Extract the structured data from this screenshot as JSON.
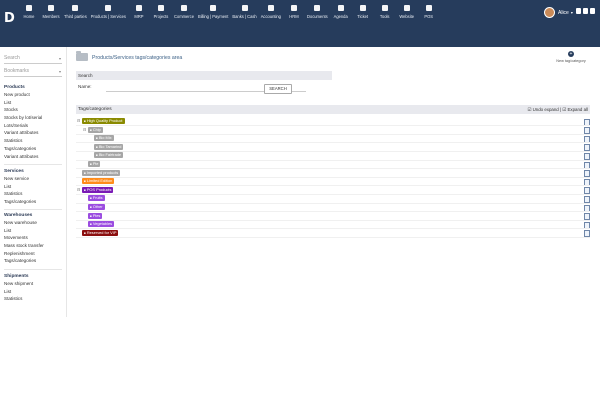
{
  "app": {
    "logo": "D"
  },
  "menu": [
    {
      "label": "Home",
      "icon": "home-icon"
    },
    {
      "label": "Members",
      "icon": "members-icon"
    },
    {
      "label": "Third parties",
      "icon": "third-parties-icon"
    },
    {
      "label": "Products | Services",
      "icon": "products-icon"
    },
    {
      "label": "MRP",
      "icon": "mrp-icon"
    },
    {
      "label": "Projects",
      "icon": "projects-icon"
    },
    {
      "label": "Commerce",
      "icon": "commerce-icon"
    },
    {
      "label": "Billing | Payment",
      "icon": "billing-icon"
    },
    {
      "label": "Banks | Cash",
      "icon": "bank-icon"
    },
    {
      "label": "Accounting",
      "icon": "accounting-icon"
    },
    {
      "label": "HRM",
      "icon": "hrm-icon"
    },
    {
      "label": "Documents",
      "icon": "documents-icon"
    },
    {
      "label": "Agenda",
      "icon": "agenda-icon"
    },
    {
      "label": "Ticket",
      "icon": "ticket-icon"
    },
    {
      "label": "Tools",
      "icon": "tools-icon"
    },
    {
      "label": "Website",
      "icon": "website-icon"
    },
    {
      "label": "POS",
      "icon": "pos-icon"
    }
  ],
  "user": {
    "name": "Alice"
  },
  "sidebar": {
    "search_placeholder": "Search",
    "bookmarks_placeholder": "Bookmarks",
    "products": {
      "title": "Products",
      "items": [
        "New product",
        "List",
        "Stocks",
        "Stocks by lot/serial",
        "Lots/Serials",
        "Variant attributes",
        "Statistics",
        "Tags/categories",
        "Variant attributes"
      ]
    },
    "services": {
      "title": "Services",
      "items": [
        "New service",
        "List",
        "Statistics",
        "Tags/categories"
      ]
    },
    "warehouses": {
      "title": "Warehouses",
      "items": [
        "New warehouse",
        "List",
        "Movements",
        "Mass stock transfer",
        "Replenishment",
        "Tags/categories"
      ]
    },
    "shipments": {
      "title": "Shipments",
      "items": [
        "New shipment",
        "List",
        "Statistics"
      ]
    }
  },
  "page": {
    "title": "Products/Services tags/categories area",
    "new_button": "New tag/category",
    "search_title": "Search",
    "name_label": "Name:",
    "search_button": "SEARCH",
    "tree_title": "Tags/categories",
    "undo_expand": "Undo expand",
    "expand_all": "Expand all"
  },
  "tree": [
    {
      "label": "High Quality Product",
      "color": "#8a8a00",
      "indent": 0,
      "toggle": "⊟"
    },
    {
      "label": "Chip",
      "color": "#a6a6a6",
      "indent": 1,
      "toggle": "⊟"
    },
    {
      "label": "Bio Mix",
      "color": "#a6a6a6",
      "indent": 2,
      "toggle": ""
    },
    {
      "label": "Bio Tamarind",
      "color": "#a6a6a6",
      "indent": 2,
      "toggle": ""
    },
    {
      "label": "Bio Fairtrade",
      "color": "#a6a6a6",
      "indent": 2,
      "toggle": ""
    },
    {
      "label": "Pie",
      "color": "#a6a6a6",
      "indent": 1,
      "toggle": ""
    },
    {
      "label": "Imported products",
      "color": "#a6a6a6",
      "indent": 0,
      "toggle": ""
    },
    {
      "label": "Limited Edition",
      "color": "#ff8c1a",
      "indent": 0,
      "toggle": ""
    },
    {
      "label": "POS Products",
      "color": "#7a1bb5",
      "indent": 0,
      "toggle": "⊟"
    },
    {
      "label": "Fruits",
      "color": "#9b4de0",
      "indent": 1,
      "toggle": ""
    },
    {
      "label": "Other",
      "color": "#9b4de0",
      "indent": 1,
      "toggle": ""
    },
    {
      "label": "Pies",
      "color": "#9b4de0",
      "indent": 1,
      "toggle": ""
    },
    {
      "label": "Vegetables",
      "color": "#9b4de0",
      "indent": 1,
      "toggle": ""
    },
    {
      "label": "Reserved for VIP",
      "color": "#8b0f0f",
      "indent": 0,
      "toggle": ""
    }
  ]
}
